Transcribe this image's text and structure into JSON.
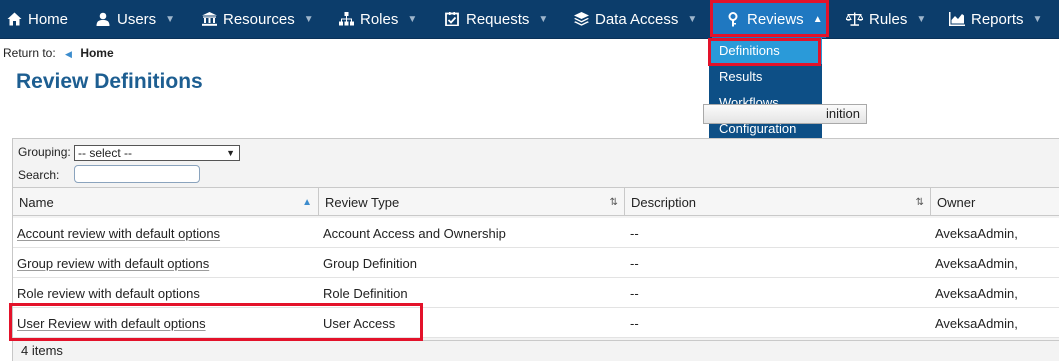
{
  "nav": {
    "items": [
      {
        "label": "Home",
        "icon": "home-icon"
      },
      {
        "label": "Users",
        "icon": "user-icon"
      },
      {
        "label": "Resources",
        "icon": "bank-icon"
      },
      {
        "label": "Roles",
        "icon": "org-chart-icon"
      },
      {
        "label": "Requests",
        "icon": "check-square-icon"
      },
      {
        "label": "Data Access",
        "icon": "layers-icon"
      },
      {
        "label": "Reviews",
        "icon": "key-icon"
      },
      {
        "label": "Rules",
        "icon": "scale-icon"
      },
      {
        "label": "Reports",
        "icon": "bar-chart-icon"
      }
    ],
    "active": "Reviews"
  },
  "reviews_menu": {
    "items": [
      "Definitions",
      "Results",
      "Workflows",
      "Configuration"
    ],
    "selected": "Definitions"
  },
  "breadcrumb": {
    "prefix": "Return to:",
    "link": "Home"
  },
  "page": {
    "title": "Review Definitions",
    "create_button_visible_text": "inition"
  },
  "filters": {
    "grouping_label": "Grouping:",
    "grouping_value": "-- select --",
    "search_label": "Search:",
    "search_value": ""
  },
  "table": {
    "columns": [
      "Name",
      "Review Type",
      "Description",
      "Owner"
    ],
    "rows": [
      {
        "name": "Account review with default options",
        "type": "Account Access and Ownership",
        "description": "--",
        "owner": "AveksaAdmin,"
      },
      {
        "name": "Group review with default options",
        "type": "Group Definition",
        "description": "--",
        "owner": "AveksaAdmin,"
      },
      {
        "name": "Role review with default options",
        "type": "Role Definition",
        "description": "--",
        "owner": "AveksaAdmin,"
      },
      {
        "name": "User Review with default options",
        "type": "User Access",
        "description": "--",
        "owner": "AveksaAdmin,"
      }
    ],
    "footer": "4 items"
  },
  "colors": {
    "nav_bg": "#0c3d6b",
    "nav_active": "#1f78c1",
    "dropdown_bg": "#0d4f86",
    "dropdown_selected": "#2a9ad9",
    "title": "#1d5e91",
    "highlight": "#e3122a"
  }
}
